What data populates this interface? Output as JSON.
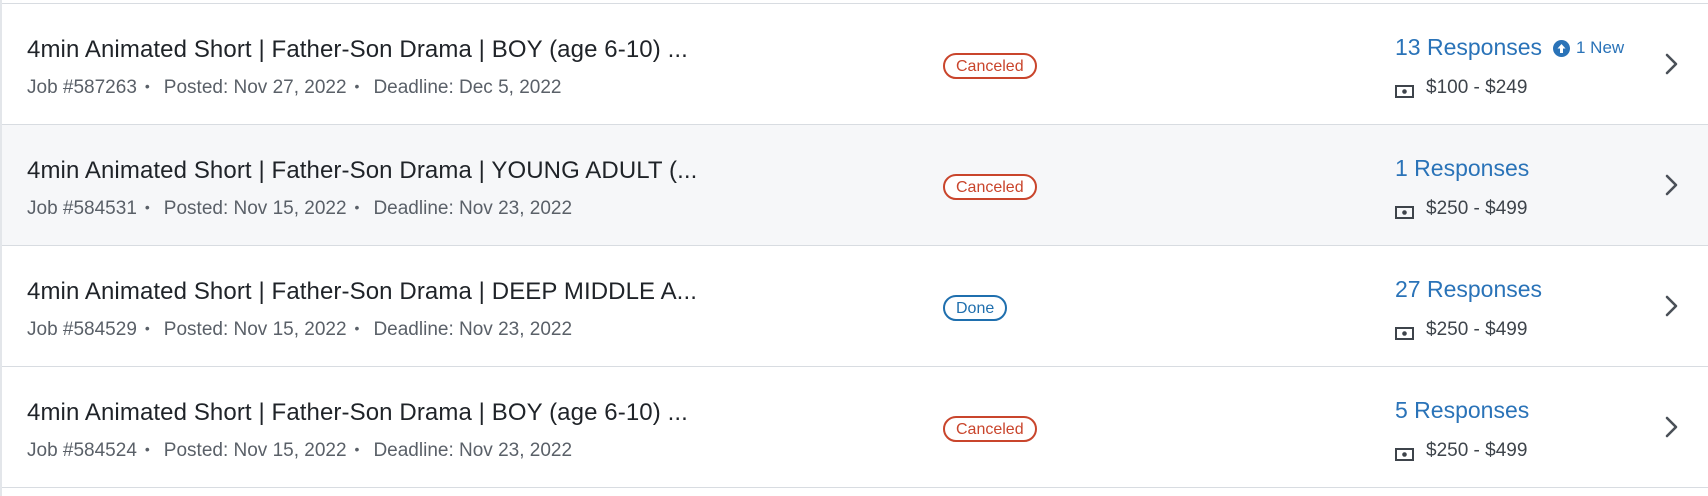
{
  "jobs": [
    {
      "title": "4min Animated Short | Father-Son Drama | BOY (age 6-10) ...",
      "job_no": "Job #587263",
      "posted": "Posted: Nov 27, 2022",
      "deadline": "Deadline: Dec 5, 2022",
      "status": "Canceled",
      "status_type": "canceled",
      "responses": "13 Responses",
      "new_label": "1 New",
      "budget": "$100 - $249"
    },
    {
      "title": "4min Animated Short | Father-Son Drama | YOUNG ADULT (...",
      "job_no": "Job #584531",
      "posted": "Posted: Nov 15, 2022",
      "deadline": "Deadline: Nov 23, 2022",
      "status": "Canceled",
      "status_type": "canceled",
      "responses": "1 Responses",
      "new_label": "",
      "budget": "$250 - $499"
    },
    {
      "title": "4min Animated Short | Father-Son Drama | DEEP MIDDLE A...",
      "job_no": "Job #584529",
      "posted": "Posted: Nov 15, 2022",
      "deadline": "Deadline: Nov 23, 2022",
      "status": "Done",
      "status_type": "done",
      "responses": "27 Responses",
      "new_label": "",
      "budget": "$250 - $499"
    },
    {
      "title": "4min Animated Short | Father-Son Drama | BOY (age 6-10) ...",
      "job_no": "Job #584524",
      "posted": "Posted: Nov 15, 2022",
      "deadline": "Deadline: Nov 23, 2022",
      "status": "Canceled",
      "status_type": "canceled",
      "responses": "5 Responses",
      "new_label": "",
      "budget": "$250 - $499"
    }
  ],
  "icons": {
    "budget": "cash-icon",
    "new": "arrow-up-circle-icon",
    "open": "chevron-right-icon"
  },
  "colors": {
    "canceled": "#c9452c",
    "done": "#1f6fae",
    "link": "#2a73b8"
  }
}
